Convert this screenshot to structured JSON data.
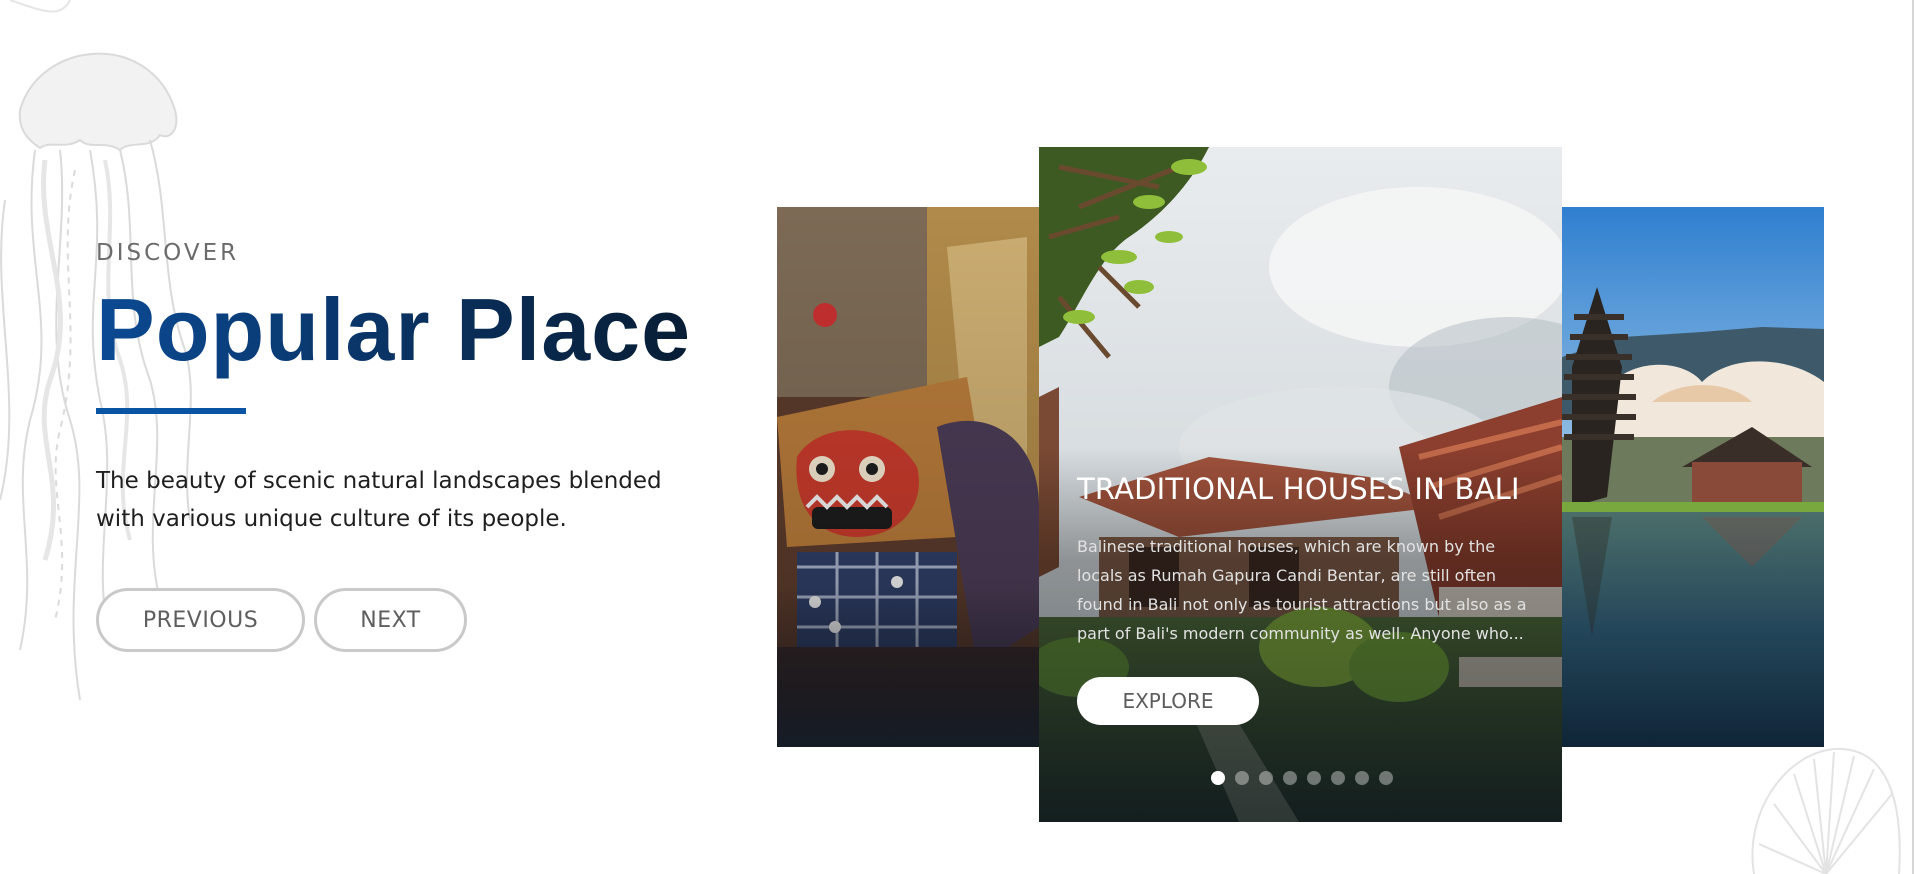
{
  "intro": {
    "eyebrow": "DISCOVER",
    "headline": "Popular Place",
    "description": "The beauty of scenic natural landscapes blended with various unique culture of its people."
  },
  "navigation": {
    "previous_label": "PREVIOUS",
    "next_label": "NEXT"
  },
  "carousel": {
    "active_slide": {
      "title": "TRADITIONAL HOUSES IN BALI",
      "description": "Balinese traditional houses, which are known by the locals as Rumah Gapura Candi Bentar, are still often found in Bali not only as tourist attractions but also as a part of Bali's modern community as well. Anyone who...",
      "button_label": "EXPLORE"
    },
    "side_slides": [
      {
        "image": "barong-mask-image"
      },
      {
        "image": "pura-ulun-danu-temple-image"
      }
    ],
    "pagination": {
      "total": 8,
      "active_index": 0
    }
  },
  "colors": {
    "headline_start": "#0b4a93",
    "headline_end": "#081b30",
    "accent_rule": "#0a55a3",
    "button_border": "#c9c9c9",
    "text_gray": "#6b6b6b"
  },
  "decorations": {
    "left": "jellyfish-line-art",
    "bottom_right": "seashell-line-art"
  }
}
